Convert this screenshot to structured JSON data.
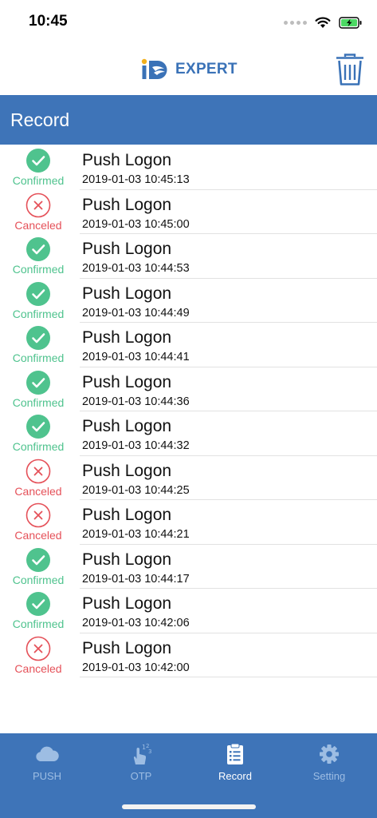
{
  "status_bar": {
    "time": "10:45"
  },
  "header": {
    "logo_text": "EXPERT",
    "logo_mark": "iD"
  },
  "title_bar": {
    "title": "Record"
  },
  "records": [
    {
      "status": "Confirmed",
      "title": "Push Logon",
      "time": "2019-01-03 10:45:13"
    },
    {
      "status": "Canceled",
      "title": "Push Logon",
      "time": "2019-01-03 10:45:00"
    },
    {
      "status": "Confirmed",
      "title": "Push Logon",
      "time": "2019-01-03 10:44:53"
    },
    {
      "status": "Confirmed",
      "title": "Push Logon",
      "time": "2019-01-03 10:44:49"
    },
    {
      "status": "Confirmed",
      "title": "Push Logon",
      "time": "2019-01-03 10:44:41"
    },
    {
      "status": "Confirmed",
      "title": "Push Logon",
      "time": "2019-01-03 10:44:36"
    },
    {
      "status": "Confirmed",
      "title": "Push Logon",
      "time": "2019-01-03 10:44:32"
    },
    {
      "status": "Canceled",
      "title": "Push Logon",
      "time": "2019-01-03 10:44:25"
    },
    {
      "status": "Canceled",
      "title": "Push Logon",
      "time": "2019-01-03 10:44:21"
    },
    {
      "status": "Confirmed",
      "title": "Push Logon",
      "time": "2019-01-03 10:44:17"
    },
    {
      "status": "Confirmed",
      "title": "Push Logon",
      "time": "2019-01-03 10:42:06"
    },
    {
      "status": "Canceled",
      "title": "Push Logon",
      "time": "2019-01-03 10:42:00"
    }
  ],
  "tabs": [
    {
      "label": "PUSH",
      "icon": "cloud-icon",
      "active": false
    },
    {
      "label": "OTP",
      "icon": "touch-123-icon",
      "active": false
    },
    {
      "label": "Record",
      "icon": "clipboard-icon",
      "active": true
    },
    {
      "label": "Setting",
      "icon": "gear-icon",
      "active": false
    }
  ],
  "colors": {
    "brand_blue": "#3e74b8",
    "confirmed_green": "#4fc38e",
    "canceled_red": "#e55159",
    "tab_inactive": "#9dbde3"
  }
}
